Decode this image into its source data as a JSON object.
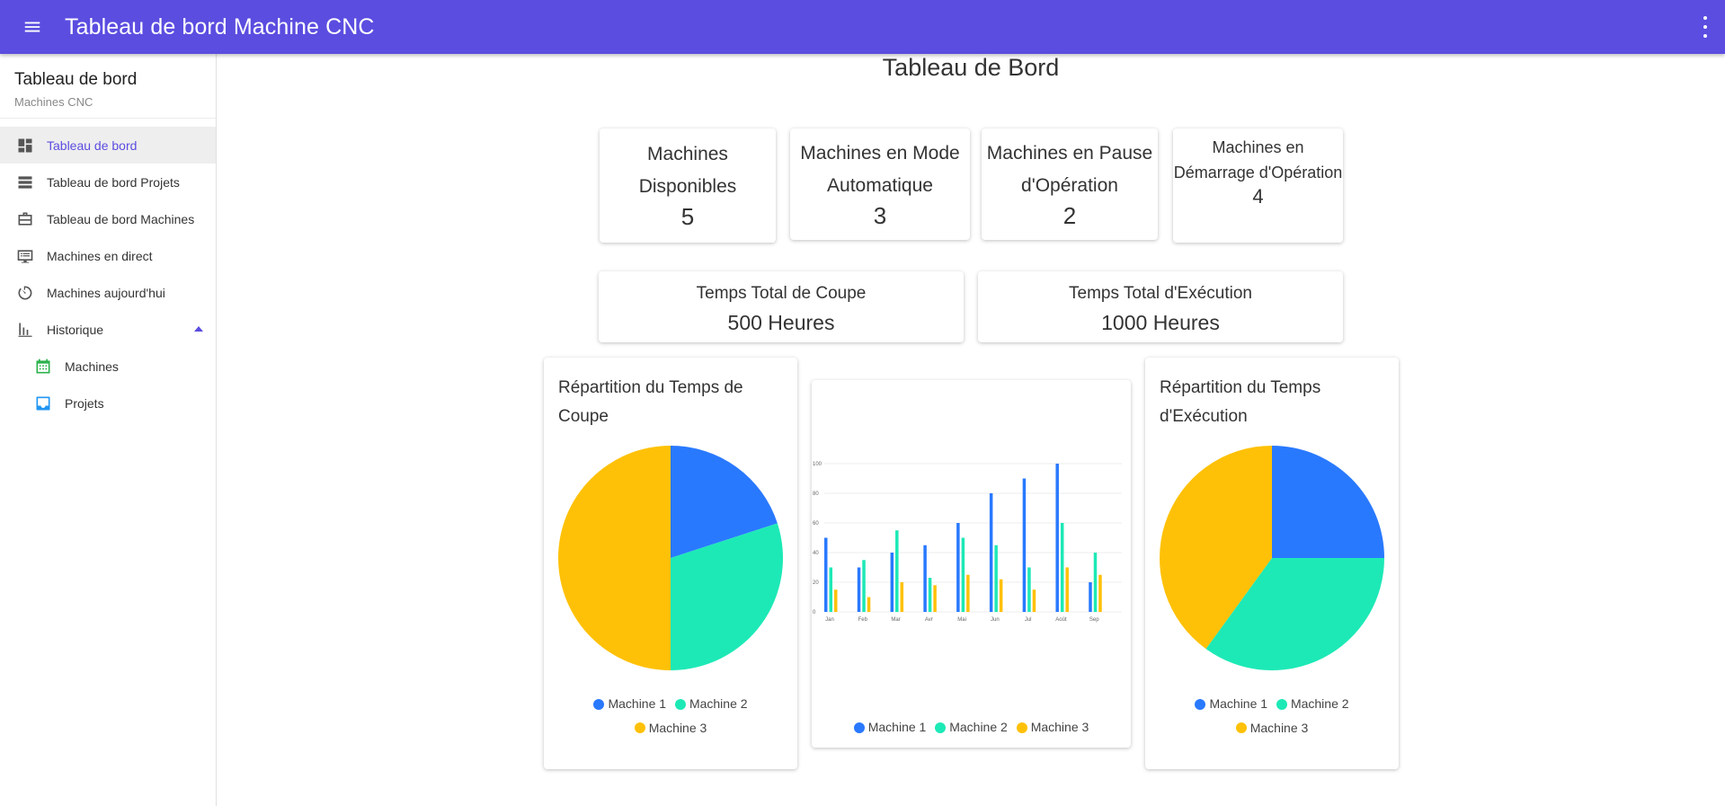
{
  "topbar": {
    "title": "Tableau de bord Machine CNC"
  },
  "sidebar": {
    "title": "Tableau de bord",
    "subtitle": "Machines CNC",
    "items": [
      {
        "label": "Tableau de bord",
        "icon": "dashboard-icon",
        "active": true
      },
      {
        "label": "Tableau de bord Projets",
        "icon": "list-view-icon"
      },
      {
        "label": "Tableau de bord Machines",
        "icon": "briefcase-icon"
      },
      {
        "label": "Machines en direct",
        "icon": "monitor-list-icon"
      },
      {
        "label": "Machines aujourd'hui",
        "icon": "timer-icon"
      },
      {
        "label": "Historique",
        "icon": "bar-chart-icon",
        "expanded": true
      },
      {
        "label": "Machines",
        "icon": "calendar-icon",
        "color": "#2bb24c"
      },
      {
        "label": "Projets",
        "icon": "inbox-icon",
        "color": "#2196f3"
      }
    ]
  },
  "page": {
    "title": "Tableau de Bord"
  },
  "stats": [
    {
      "label": "Machines Disponibles",
      "value": "5"
    },
    {
      "label": "Machines en Mode Automatique",
      "value": "3"
    },
    {
      "label": "Machines en Pause d'Opération",
      "value": "2"
    },
    {
      "label": "Machines en Démarrage d'Opération",
      "value": "4"
    }
  ],
  "times": [
    {
      "label": "Temps Total de Coupe",
      "value": "500 Heures"
    },
    {
      "label": "Temps Total d'Exécution",
      "value": "1000 Heures"
    }
  ],
  "colors": {
    "accent": "#5b4de0",
    "machine1": "#2979ff",
    "machine2": "#1de9b6",
    "machine3": "#ffc107"
  },
  "chart_data": [
    {
      "type": "pie",
      "title": "Répartition du Temps de Coupe",
      "labels": [
        "Machine 1",
        "Machine 2",
        "Machine 3"
      ],
      "values": [
        20,
        30,
        50
      ],
      "legend": "bottom"
    },
    {
      "type": "bar",
      "title": "",
      "categories": [
        "Jan",
        "Feb",
        "Mar",
        "Avr",
        "Mai",
        "Jun",
        "Jul",
        "Août",
        "Sep"
      ],
      "series": [
        {
          "name": "Machine 1",
          "values": [
            50,
            30,
            40,
            45,
            60,
            80,
            90,
            100,
            20
          ]
        },
        {
          "name": "Machine 2",
          "values": [
            30,
            35,
            55,
            23,
            50,
            45,
            30,
            60,
            40
          ]
        },
        {
          "name": "Machine 3",
          "values": [
            15,
            10,
            20,
            18,
            25,
            22,
            15,
            30,
            25
          ]
        }
      ],
      "yticks": [
        "0",
        "20",
        "40",
        "60",
        "80",
        "100"
      ],
      "ylim": [
        0,
        100
      ],
      "grid": true,
      "legend": "bottom"
    },
    {
      "type": "pie",
      "title": "Répartition du Temps d'Exécution",
      "labels": [
        "Machine 1",
        "Machine 2",
        "Machine 3"
      ],
      "values": [
        25,
        35,
        40
      ],
      "legend": "bottom"
    }
  ]
}
